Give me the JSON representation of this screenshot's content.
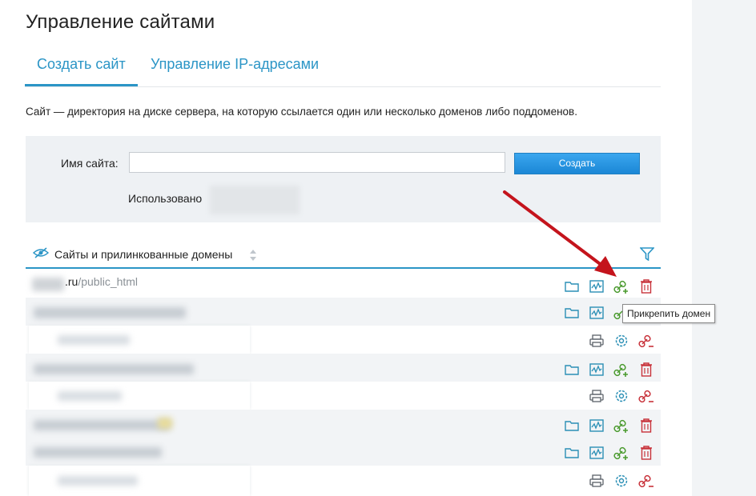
{
  "page": {
    "title": "Управление сайтами"
  },
  "tabs": [
    {
      "label": "Создать сайт",
      "active": true
    },
    {
      "label": "Управление IP-адресами",
      "active": false
    }
  ],
  "description": "Сайт — директория на диске сервера, на которую ссылается один или несколько доменов либо поддоменов.",
  "form": {
    "site_name_label": "Имя сайта:",
    "site_name_value": "",
    "create_button": "Создать",
    "used_label": "Использовано"
  },
  "table": {
    "header": "Сайты и прилинкованные домены",
    "first_row": {
      "domain_suffix": ".ru",
      "path": "/public_html"
    }
  },
  "tooltip": "Прикрепить домен",
  "colors": {
    "accent": "#2b95c6",
    "button": "#1b87d6",
    "icon_teal": "#2a8fb5",
    "icon_green": "#4a9a2e",
    "icon_red": "#c8323a",
    "arrow": "#c4141c"
  }
}
